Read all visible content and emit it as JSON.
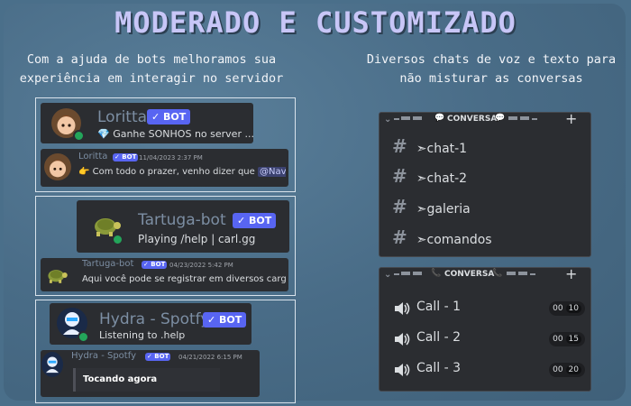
{
  "title": "MODERADO E CUSTOMIZADO",
  "left_subtitle": [
    "Com a ajuda de bots melhoramos sua",
    "experiência em interagir no servidor"
  ],
  "right_subtitle": [
    "Diversos chats de voz e texto para",
    "não misturar as conversas"
  ],
  "bot_badge": "✓ BOT",
  "bots": [
    {
      "name": "Loritta",
      "status": "💎 Ganhe SONHOS no server ...",
      "msg_name": "Loritta",
      "msg_time": "11/04/2023 2:37 PM",
      "msg_text": "👉 Com todo o prazer, venho dizer que",
      "msg_mention": "@Navez"
    },
    {
      "name": "Tartuga-bot",
      "status": "Playing /help | carl.gg",
      "msg_name": "Tartuga-bot",
      "msg_time": "04/23/2022 5:42 PM",
      "msg_text": "Aqui você pode se registrar em diversos cargo"
    },
    {
      "name": "Hydra - Spotfy",
      "status": "Listening to .help",
      "msg_name": "Hydra - Spotfy",
      "msg_time": "04/21/2022 6:15 PM",
      "msg_text": "Tocando agora"
    }
  ],
  "text_category": {
    "label": "CONVERSA",
    "channels": [
      "➣chat-1",
      "➣chat-2",
      "➣galeria",
      "➣comandos"
    ]
  },
  "voice_category": {
    "label": "CONVERSA",
    "calls": [
      {
        "name": "Call - 1",
        "count": "00",
        "limit": "10"
      },
      {
        "name": "Call - 2",
        "count": "00",
        "limit": "15"
      },
      {
        "name": "Call - 3",
        "count": "00",
        "limit": "20"
      }
    ]
  },
  "icons": {
    "hash": "#",
    "chevron": "⌄",
    "plus": "+",
    "speech": "💬",
    "phone": "📞",
    "gem": "💎",
    "speaker": "speaker-icon"
  },
  "colors": {
    "background": "#4a6f8a",
    "title": "#c8c6f7",
    "panel": "#2b2d31",
    "bot_badge": "#5865f2",
    "online": "#23a55a"
  }
}
